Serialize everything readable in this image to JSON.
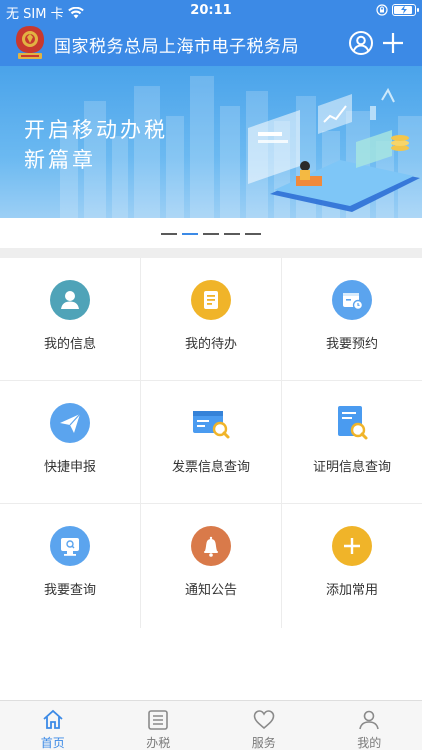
{
  "status": {
    "carrier": "无 SIM 卡",
    "time": "20:11",
    "battery_level": 0.95
  },
  "header": {
    "title": "国家税务总局上海市电子税务局",
    "icons": [
      "emblem-logo",
      "user-icon",
      "plus-icon"
    ]
  },
  "banner": {
    "line1": "开启移动办税",
    "line2": "新篇章",
    "slides": 5,
    "active_slide": 2
  },
  "grid": [
    {
      "label": "我的信息",
      "icon": "person-icon",
      "color": "#4fa3b8"
    },
    {
      "label": "我的待办",
      "icon": "document-list-icon",
      "color": "#f0b429"
    },
    {
      "label": "我要预约",
      "icon": "calendar-clock-icon",
      "color": "#5ba4ee"
    },
    {
      "label": "快捷申报",
      "icon": "paper-plane-icon",
      "color": "#5ba4ee"
    },
    {
      "label": "发票信息查询",
      "icon": "invoice-search-icon",
      "color": "#5ba4ee"
    },
    {
      "label": "证明信息查询",
      "icon": "certificate-search-icon",
      "color": "#5ba4ee"
    },
    {
      "label": "我要查询",
      "icon": "monitor-search-icon",
      "color": "#5ba4ee"
    },
    {
      "label": "通知公告",
      "icon": "bell-icon",
      "color": "#d97a4a"
    },
    {
      "label": "添加常用",
      "icon": "plus-icon",
      "color": "#f0b429"
    }
  ],
  "tabs": [
    {
      "label": "首页",
      "icon": "home-icon",
      "active": true
    },
    {
      "label": "办税",
      "icon": "list-icon",
      "active": false
    },
    {
      "label": "服务",
      "icon": "heart-icon",
      "active": false
    },
    {
      "label": "我的",
      "icon": "person-outline-icon",
      "active": false
    }
  ]
}
